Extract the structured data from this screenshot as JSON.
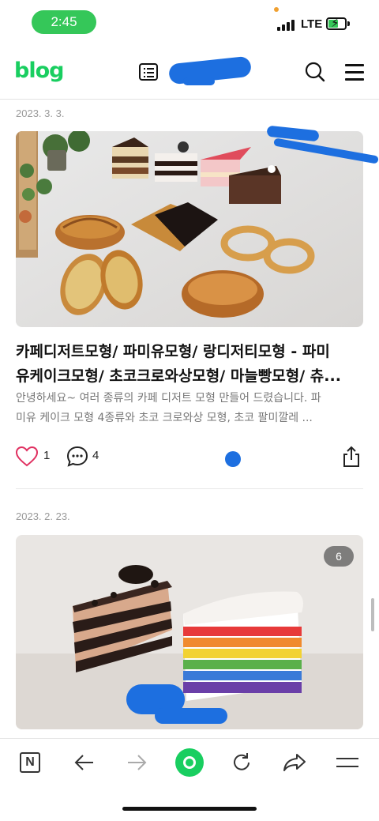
{
  "status_bar": {
    "time": "2:45",
    "network": "LTE"
  },
  "header": {
    "logo": "blog",
    "icons": [
      "list-icon",
      "search-icon",
      "menu-icon"
    ]
  },
  "posts": [
    {
      "date": "2023. 3. 3.",
      "title_line1": "카페디저트모형/ 파미유모형/ 랑디저티모형 - 파미",
      "title_line2": "유케이크모형/ 초코크로와상모형/ 마늘빵모형/ 츄...",
      "excerpt_line1": "안녕하세요~ 여러 종류의 카페 디저트 모형 만들어 드렸습니다. 파",
      "excerpt_line2": "미유 케이크 모형 4종류와 초코 크로와상 모형, 초코 팔미깔레 ...",
      "likes": "1",
      "comments": "4"
    },
    {
      "date": "2023. 2. 23.",
      "image_count": "6"
    }
  ],
  "colors": {
    "brand": "#19ce60",
    "redaction": "#1d6fe0",
    "heart": "#e03060",
    "status_pill": "#35c759"
  },
  "bottom_nav": [
    "naver-icon",
    "back-icon",
    "forward-icon",
    "home-icon",
    "refresh-icon",
    "share-icon",
    "menu-icon"
  ]
}
